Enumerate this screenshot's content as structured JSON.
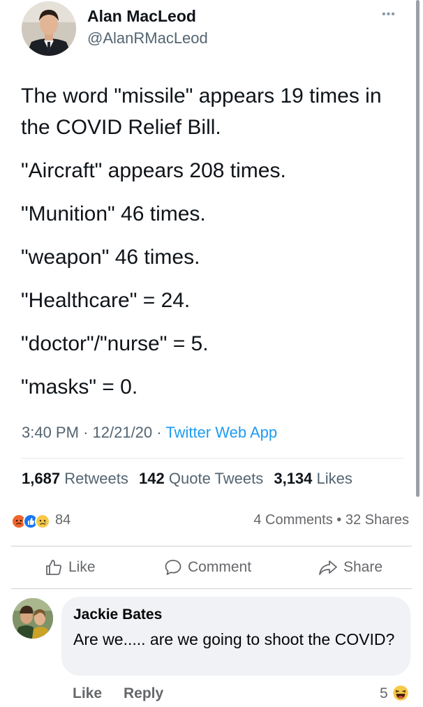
{
  "tweet": {
    "author_name": "Alan MacLeod",
    "author_handle": "@AlanRMacLeod",
    "more_icon": "more-dots-icon",
    "first_paragraph_lines": [
      "The word \"missile\" appears 19 times in",
      "the COVID Relief Bill."
    ],
    "paragraphs": [
      "\"Aircraft\" appears 208 times.",
      "\"Munition\" 46 times.",
      "\"weapon\" 46 times.",
      "\"Healthcare\" = 24.",
      "\"doctor\"/\"nurse\" = 5.",
      "\"masks\" = 0."
    ],
    "time": "3:40 PM",
    "date": "12/21/20",
    "source": "Twitter Web App",
    "retweets_count": "1,687",
    "retweets_label": "Retweets",
    "quotes_count": "142",
    "quotes_label": "Quote Tweets",
    "likes_count": "3,134",
    "likes_label": "Likes"
  },
  "facebook": {
    "reactions": [
      "angry-reaction-icon",
      "like-reaction-icon",
      "sad-reaction-icon"
    ],
    "reaction_count": "84",
    "comments_shares": "4 Comments • 32 Shares",
    "actions": {
      "like": "Like",
      "comment": "Comment",
      "share": "Share"
    },
    "comment": {
      "author": "Jackie Bates",
      "text": "Are we..... are we going to shoot the COVID?",
      "like_label": "Like",
      "reply_label": "Reply",
      "reaction_count": "5",
      "reaction_icon": "laughing-reaction-icon"
    }
  },
  "colors": {
    "twitter_link": "#1d9bf0",
    "secondary_text": "#536471",
    "fb_secondary": "#65676b",
    "fb_blue": "#1877f2",
    "comment_bubble": "#f0f2f5"
  }
}
